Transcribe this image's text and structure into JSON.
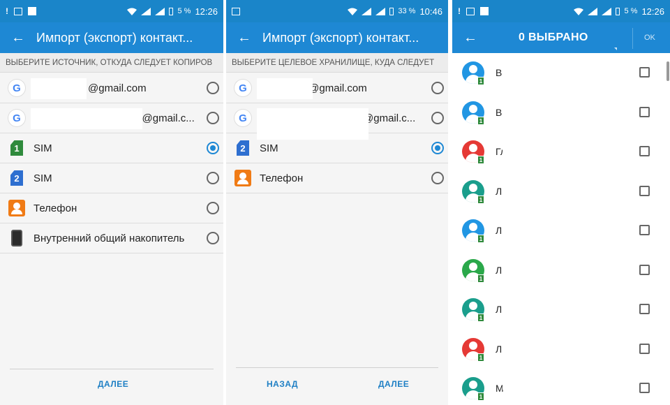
{
  "panels": [
    {
      "status": {
        "battery": "5 %",
        "time": "12:26"
      },
      "title": "Импорт (экспорт) контакт...",
      "subheading": "ВЫБЕРИТЕ ИСТОЧНИК, ОТКУДА СЛЕДУЕТ КОПИРОВ",
      "items": [
        {
          "icon": "google-icon",
          "label": "@gmail.com",
          "selected": false
        },
        {
          "icon": "google-icon",
          "label": "y@gmail.c...",
          "selected": false
        },
        {
          "icon": "sim-1-icon",
          "sim": "1",
          "label": "SIM",
          "selected": true
        },
        {
          "icon": "sim-2-icon",
          "sim": "2",
          "label": "SIM",
          "selected": false
        },
        {
          "icon": "contacts-phone-icon",
          "label": "Телефон",
          "selected": false
        },
        {
          "icon": "device-storage-icon",
          "label": "Внутренний общий накопитель",
          "selected": false
        }
      ],
      "footer": {
        "next": "ДАЛЕЕ"
      }
    },
    {
      "status": {
        "battery": "33 %",
        "time": "10:46"
      },
      "title": "Импорт (экспорт) контакт...",
      "subheading": "ВЫБЕРИТЕ ЦЕЛЕВОЕ ХРАНИЛИЩЕ, КУДА СЛЕДУЕТ",
      "items": [
        {
          "icon": "google-icon",
          "label": ":@gmail.com",
          "selected": false
        },
        {
          "icon": "google-icon",
          "label": "@gmail.c...",
          "selected": false
        },
        {
          "icon": "sim-2-icon",
          "sim": "2",
          "label": "SIM",
          "selected": true
        },
        {
          "icon": "contacts-phone-icon",
          "label": "Телефон",
          "selected": false
        }
      ],
      "footer": {
        "back": "НАЗАД",
        "next": "ДАЛЕЕ"
      }
    },
    {
      "status": {
        "battery": "5 %",
        "time": "12:26"
      },
      "title": "0 ВЫБРАНО",
      "ok": "OK",
      "contacts": [
        {
          "initial": "Ва",
          "color": "#2196e3"
        },
        {
          "initial": "Ве",
          "color": "#2196e3"
        },
        {
          "initial": "Гл",
          "color": "#e53935"
        },
        {
          "initial": "Л",
          "color": "#1a9e8c"
        },
        {
          "initial": "Л",
          "color": "#2196e3"
        },
        {
          "initial": "Л",
          "color": "#2aa84a"
        },
        {
          "initial": "Л",
          "color": "#1a9e8c"
        },
        {
          "initial": "Л",
          "color": "#e53935"
        },
        {
          "initial": "М",
          "color": "#1a9e8c"
        }
      ]
    }
  ],
  "colors": {
    "statusbar": "#1a85c9",
    "appbar": "#1e88d4",
    "accent": "#1e7fc4"
  }
}
